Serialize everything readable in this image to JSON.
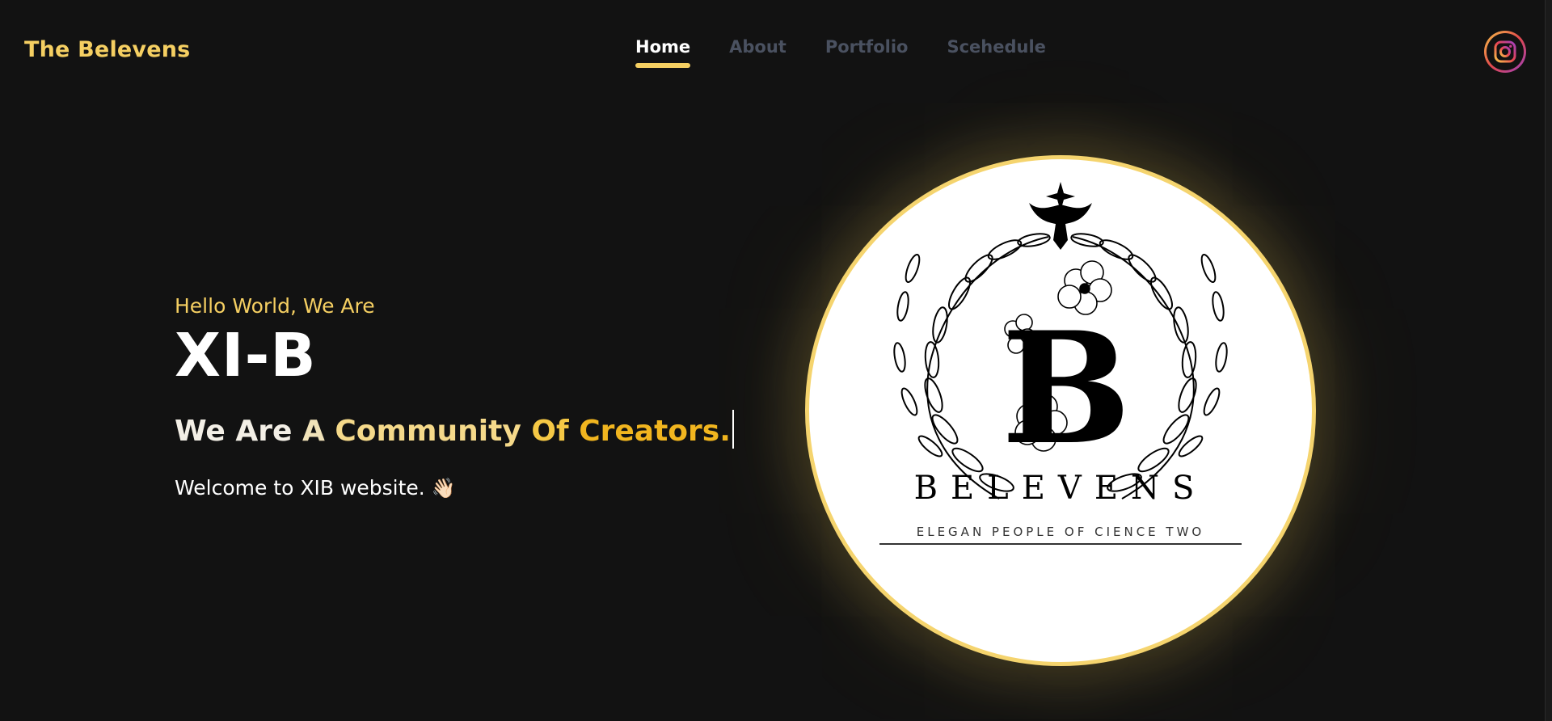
{
  "header": {
    "brand": "The Belevens",
    "nav": [
      {
        "label": "Home",
        "active": true
      },
      {
        "label": "About",
        "active": false
      },
      {
        "label": "Portfolio",
        "active": false
      },
      {
        "label": "Scehedule",
        "active": false
      }
    ],
    "social_icon": "instagram-icon"
  },
  "hero": {
    "greeting": "Hello World, We Are",
    "title": "XI-B",
    "tagline_words": [
      "We Are",
      "A",
      "Community",
      "Of",
      "Creators."
    ],
    "welcome": "Welcome to XIB website.",
    "welcome_emoji": "👋🏻"
  },
  "logo": {
    "letter": "B",
    "name": "BELEVENS",
    "subtitle": "ELEGAN PEOPLE OF CIENCE TWO"
  },
  "colors": {
    "background": "#121212",
    "accent": "#f5cf62",
    "nav_inactive": "#4a5160"
  }
}
